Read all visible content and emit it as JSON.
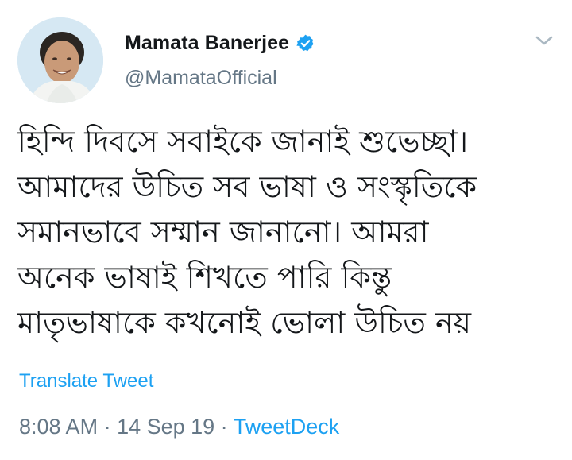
{
  "author": {
    "display_name": "Mamata Banerjee",
    "handle": "@MamataOfficial",
    "verified": true,
    "avatar_icon": "profile-photo"
  },
  "tweet": {
    "lines": [
      "হিন্দি দিবসে সবাইকে জানাই শুভেচ্ছা।",
      "আমাদের উচিত সব ভাষা ও সংস্কৃতিকে",
      "সমানভাবে সম্মান জানানো। আমরা",
      "অনেক ভাষাই শিখতে পারি কিন্তু",
      "মাতৃভাষাকে কখনোই ভোলা উচিত নয়"
    ],
    "translate_label": "Translate Tweet",
    "time": "8:08 AM",
    "separator1": " · ",
    "date": "14 Sep 19",
    "separator2": " · ",
    "source": "TweetDeck"
  },
  "colors": {
    "accent": "#1da1f2",
    "secondary_text": "#657786",
    "primary_text": "#14171a"
  }
}
